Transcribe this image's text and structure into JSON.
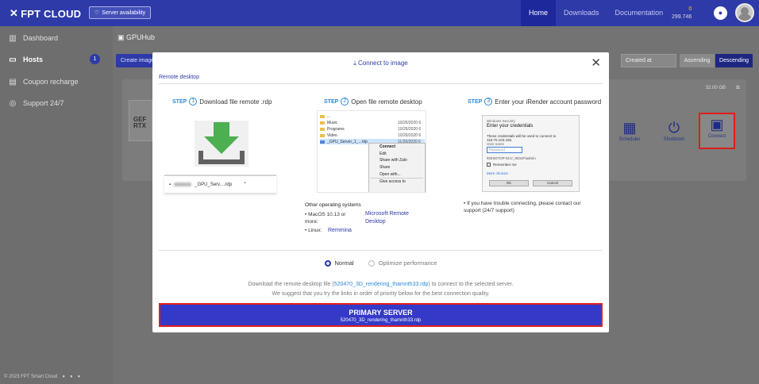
{
  "topbar": {
    "logo": "FPT CLOUD",
    "server_availability": "Server availability",
    "nav": [
      "Home",
      "Downloads",
      "Documentation"
    ],
    "wallet_top": "0",
    "wallet_bottom": "299.746"
  },
  "sidebar": {
    "items": [
      {
        "label": "Dashboard",
        "icon": "dashboard-icon"
      },
      {
        "label": "Hosts",
        "icon": "monitor-icon",
        "badge": "1"
      },
      {
        "label": "Coupon recharge",
        "icon": "coupon-icon"
      },
      {
        "label": "Support 24/7",
        "icon": "support-icon"
      }
    ],
    "footer": "© 2023 FPT Smart Cloud"
  },
  "main": {
    "breadcrumb": "GPUHub",
    "create_button": "Create image",
    "sort_select": "Created at",
    "sort_asc": "Ascending",
    "sort_desc": "Descending",
    "card": {
      "storage": "32.00 GB",
      "gpu_label_1": "GEF",
      "gpu_label_2": "RTX",
      "actions": [
        "Scheduler",
        "Shutdown",
        "Connect"
      ]
    }
  },
  "modal": {
    "title": "Connect to image",
    "tab": "Remote desktop",
    "steps": [
      {
        "label": "STEP",
        "num": "1",
        "text": "Download file remote .rdp"
      },
      {
        "label": "STEP",
        "num": "2",
        "text": "Open file remote desktop"
      },
      {
        "label": "STEP",
        "num": "3",
        "text": "Enter your iRender account password"
      }
    ],
    "download_file": "_GPU_Serv....rdp",
    "explorer": {
      "rows": [
        {
          "name": "Music",
          "date": "10/26/2020 6"
        },
        {
          "name": "Programs",
          "date": "10/26/2020 6"
        },
        {
          "name": "Video",
          "date": "10/26/2020 6"
        },
        {
          "name": "_GPU_Server_1_...rdp",
          "date": "11/26/2020 6"
        }
      ],
      "menu": [
        "Connect",
        "Edit",
        "Share with Zalo",
        "Share",
        "Open with...",
        "Give access to"
      ]
    },
    "other_os": {
      "title": "Other operating systems",
      "mac_label": "MacOS 10.13 or more:",
      "mac_link": "Microsoft Remote Desktop",
      "linux_label": "Linux:",
      "linux_link": "Remmina"
    },
    "credentials": {
      "header": "Windows Security",
      "title": "Enter your credentials",
      "line1": "These credentials will be used to connect to 118.70.103.156.",
      "user_label": "User name",
      "password_placeholder": "Password",
      "account": "\\DESKTOP-5CV_9034F\\admin",
      "remember": "Remember me",
      "more": "More choices",
      "ok": "OK",
      "cancel": "Cancel"
    },
    "help_text": "If you have trouble connecting, please contact our support (24/7 support)",
    "options": {
      "normal": "Normal",
      "optimize": "Optimize performance"
    },
    "note1_pre": "Download the remote desktop file (",
    "note1_link": "520470_3D_rendering_thamnth33.rdp",
    "note1_post": ") to connect to the selected server.",
    "note2": "We suggest that you try the links in order of priority below for the best connection quality.",
    "primary_title": "PRIMARY SERVER",
    "primary_sub": "520470_3D_rendering_thamnth33.rdp"
  }
}
